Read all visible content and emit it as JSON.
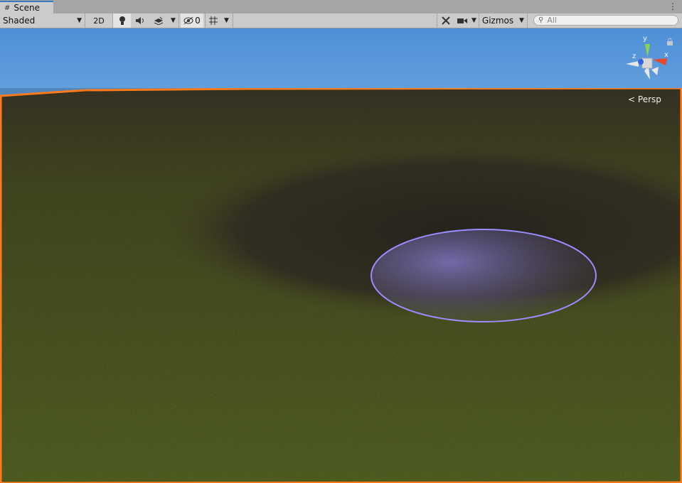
{
  "tab": {
    "label": "Scene",
    "icon": "grid-icon"
  },
  "toolbar": {
    "draw_mode": "Shaded",
    "mode_2d": "2D",
    "hidden_count": "0",
    "gizmos_label": "Gizmos",
    "search_placeholder": "All"
  },
  "viewport": {
    "projection_label": "Persp",
    "axis_x": "x",
    "axis_y": "y",
    "axis_z": "z",
    "selection_outline_color": "#ff7a1a",
    "brush_color": "#9b8cff"
  }
}
